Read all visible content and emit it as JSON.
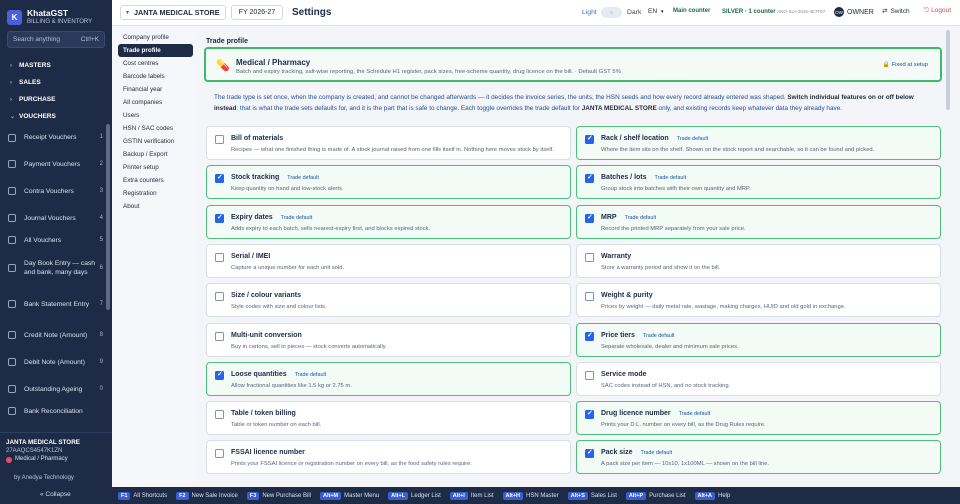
{
  "brand": {
    "logo": "K",
    "name": "KhataGST",
    "subtitle": "BILLING & INVENTORY"
  },
  "sidebar": {
    "search_placeholder": "Search anything",
    "search_shortcut": "Ctrl+K",
    "sections": {
      "masters": "MASTERS",
      "sales": "SALES",
      "purchase": "PURCHASE",
      "vouchers": "VOUCHERS"
    },
    "items": [
      {
        "label": "Receipt Vouchers",
        "num": "1"
      },
      {
        "label": "Payment Vouchers",
        "num": "2"
      },
      {
        "label": "Contra Vouchers",
        "num": "3"
      },
      {
        "label": "Journal Vouchers",
        "num": "4"
      },
      {
        "label": "All Vouchers",
        "num": "5"
      },
      {
        "label": "Day Book Entry — cash and bank, many days",
        "num": "6"
      },
      {
        "label": "Bank Statement Entry",
        "num": "7"
      },
      {
        "label": "Credit Note (Amount)",
        "num": "8"
      },
      {
        "label": "Debit Note (Amount)",
        "num": "9"
      },
      {
        "label": "Outstanding Ageing",
        "num": "0"
      },
      {
        "label": "Bank Reconciliation",
        "num": ""
      }
    ],
    "company": "JANTA MEDICAL STORE",
    "gstin": "27AAQCS4547K1ZN",
    "profile": "Medical / Pharmacy",
    "by": "by Anedya Technology",
    "collapse": "« Collapse"
  },
  "topbar": {
    "company": "JANTA MEDICAL STORE",
    "fy": "FY 2026-27",
    "title": "Settings",
    "light": "Light",
    "toggle": "○",
    "dark": "Dark",
    "lang": "EN",
    "counter": "Main counter",
    "license": "SILVER · 1 counter",
    "license_key": "ANO-SLV-2026-4E7F97",
    "avatar": "OW",
    "owner": "OWNER",
    "switch": "Switch",
    "logout": "Logout"
  },
  "setnav": [
    "Company profile",
    "Trade profile",
    "Cost centres",
    "Barcode labels",
    "Financial year",
    "All companies",
    "Users",
    "HSN / SAC codes",
    "GSTIN verification",
    "Backup / Export",
    "Printer setup",
    "Extra counters",
    "Registration",
    "About"
  ],
  "main": {
    "section_title": "Trade profile",
    "profile_name": "Medical / Pharmacy",
    "profile_desc": "Batch and expiry tracking, salt-wise reporting, the Schedule H1 register, pack sizes, free-scheme quantity, drug licence on the bill. · Default GST 5%",
    "fixed": "Fixed at setup",
    "expl_a": "The trade type is set once, when the company is created, and cannot be changed afterwards — it decides the invoice series, the units, the HSN seeds and how every record already entered was shaped.",
    "expl_b": "Switch individual features on or off below instead",
    "expl_c": ": that is what the trade sets defaults for, and it is the part that is safe to change. Each toggle overrides the trade default for",
    "expl_d": "JANTA MEDICAL STORE",
    "expl_e": "only, and existing records keep whatever data they already have."
  },
  "features": [
    {
      "name": "Bill of materials",
      "on": false,
      "tag": "",
      "desc": "Recipes — what one finished thing is made of. A stock journal raised from one fills itself in. Nothing here moves stock by itself."
    },
    {
      "name": "Rack / shelf location",
      "on": true,
      "tag": "Trade default",
      "desc": "Where the item sits on the shelf. Shown on the stock report and searchable, so it can be found and picked."
    },
    {
      "name": "Stock tracking",
      "on": true,
      "tag": "Trade default",
      "desc": "Keep quantity on hand and low-stock alerts."
    },
    {
      "name": "Batches / lots",
      "on": true,
      "tag": "Trade default",
      "desc": "Group stock into batches with their own quantity and MRP."
    },
    {
      "name": "Expiry dates",
      "on": true,
      "tag": "Trade default",
      "desc": "Adds expiry to each batch, sells nearest-expiry first, and blocks expired stock."
    },
    {
      "name": "MRP",
      "on": true,
      "tag": "Trade default",
      "desc": "Record the printed MRP separately from your sale price."
    },
    {
      "name": "Serial / IMEI",
      "on": false,
      "tag": "",
      "desc": "Capture a unique number for each unit sold."
    },
    {
      "name": "Warranty",
      "on": false,
      "tag": "",
      "desc": "Store a warranty period and show it on the bill."
    },
    {
      "name": "Size / colour variants",
      "on": false,
      "tag": "",
      "desc": "Style codes with size and colour lists."
    },
    {
      "name": "Weight & purity",
      "on": false,
      "tag": "",
      "desc": "Prices by weight — daily metal rate, wastage, making charges, HUID and old gold in exchange."
    },
    {
      "name": "Multi-unit conversion",
      "on": false,
      "tag": "",
      "desc": "Buy in cartons, sell in pieces — stock converts automatically."
    },
    {
      "name": "Price tiers",
      "on": true,
      "tag": "Trade default",
      "desc": "Separate wholesale, dealer and minimum sale prices."
    },
    {
      "name": "Loose quantities",
      "on": true,
      "tag": "Trade default",
      "desc": "Allow fractional quantities like 1.5 kg or 2.75 m."
    },
    {
      "name": "Service mode",
      "on": false,
      "tag": "",
      "desc": "SAC codes instead of HSN, and no stock tracking."
    },
    {
      "name": "Table / token billing",
      "on": false,
      "tag": "",
      "desc": "Table or token number on each bill."
    },
    {
      "name": "Drug licence number",
      "on": true,
      "tag": "Trade default",
      "desc": "Prints your D.L. number on every bill, as the Drug Rules require."
    },
    {
      "name": "FSSAI licence number",
      "on": false,
      "tag": "",
      "desc": "Prints your FSSAI licence or registration number on every bill, as the food safety rules require."
    },
    {
      "name": "Pack size",
      "on": true,
      "tag": "Trade default",
      "desc": "A pack size per item — 10x10, 1x100ML — shown on the bill line."
    }
  ],
  "shortcuts": [
    {
      "key": "F1",
      "label": "All Shortcuts"
    },
    {
      "key": "F2",
      "label": "New Sale Invoice"
    },
    {
      "key": "F3",
      "label": "New Purchase Bill"
    },
    {
      "key": "Alt+M",
      "label": "Master Menu"
    },
    {
      "key": "Alt+L",
      "label": "Ledger List"
    },
    {
      "key": "Alt+I",
      "label": "Item List"
    },
    {
      "key": "Alt+H",
      "label": "HSN Master"
    },
    {
      "key": "Alt+S",
      "label": "Sales List"
    },
    {
      "key": "Alt+P",
      "label": "Purchase List"
    },
    {
      "key": "Alt+A",
      "label": "Help"
    }
  ],
  "colors": {
    "sidebar": "#1d2b47",
    "accent": "#2563eb",
    "enabled_border": "#4cc07a",
    "link": "#1d4fa3"
  }
}
